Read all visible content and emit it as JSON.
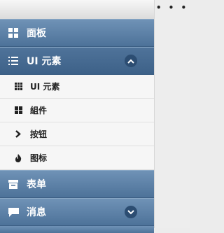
{
  "topbar": {
    "dots": "• • •"
  },
  "nav": {
    "dashboard": {
      "label": "面板",
      "icon": "grid-icon"
    },
    "ui_elements": {
      "label": "UI 元素",
      "icon": "list-icon",
      "expanded": true,
      "children": [
        {
          "label": "UI 元素",
          "icon": "small-grid-icon"
        },
        {
          "label": "組件",
          "icon": "grid-icon"
        },
        {
          "label": "按钮",
          "icon": "chevron-right-icon"
        },
        {
          "label": "图标",
          "icon": "flame-icon"
        }
      ]
    },
    "forms": {
      "label": "表单",
      "icon": "inbox-icon"
    },
    "messages": {
      "label": "消息",
      "icon": "chat-icon"
    }
  },
  "colors": {
    "nav_bg": "#5a7fa6",
    "nav_active": "#42668d",
    "sub_bg": "#f6f6f6"
  }
}
